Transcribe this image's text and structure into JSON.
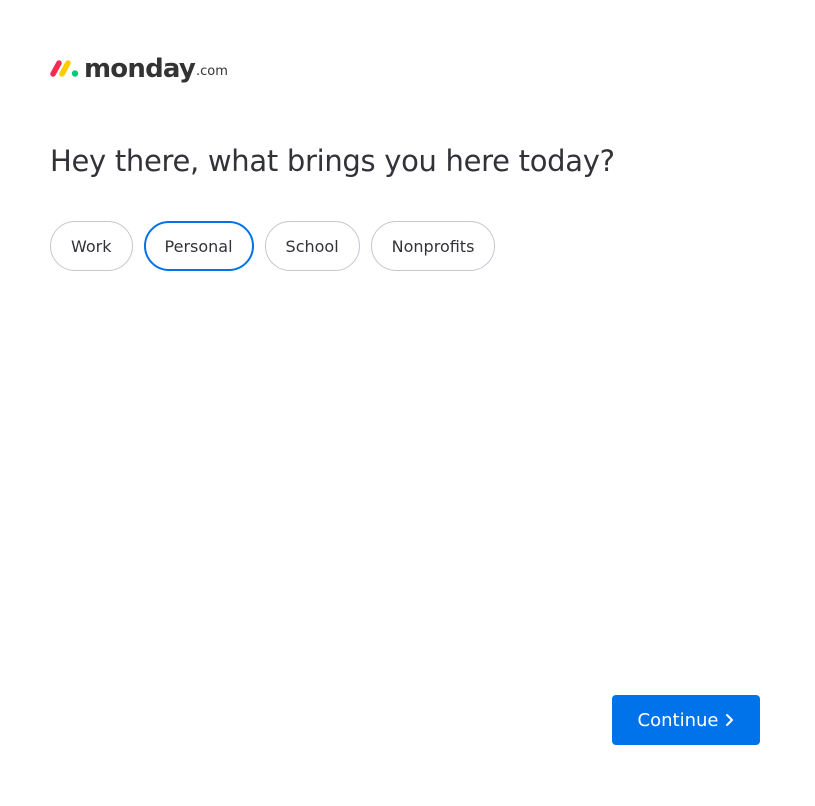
{
  "brand": {
    "name": "monday",
    "tld": ".com",
    "logo_colors": [
      "#f62b54",
      "#ffcc00",
      "#00ca72"
    ]
  },
  "question": {
    "title": "Hey there, what brings you here today?"
  },
  "options": [
    {
      "label": "Work",
      "selected": false
    },
    {
      "label": "Personal",
      "selected": true
    },
    {
      "label": "School",
      "selected": false
    },
    {
      "label": "Nonprofits",
      "selected": false
    }
  ],
  "actions": {
    "continue_label": "Continue",
    "continue_icon": "chevron-right-icon",
    "accent_color": "#0073ea"
  }
}
